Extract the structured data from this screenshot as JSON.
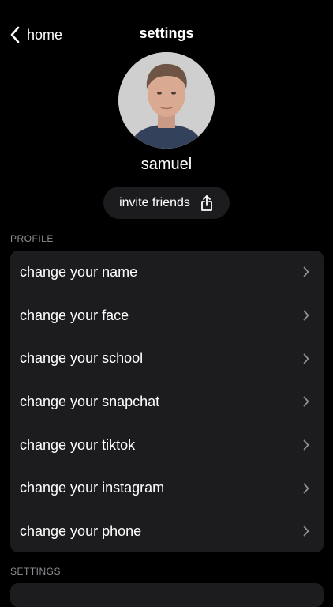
{
  "nav": {
    "back_label": "home",
    "title": "settings"
  },
  "profile": {
    "username": "samuel",
    "invite_label": "invite friends"
  },
  "sections": {
    "profile_header": "PROFILE",
    "settings_header": "SETTINGS"
  },
  "profile_items": [
    {
      "label": "change your name"
    },
    {
      "label": "change your face"
    },
    {
      "label": "change your school"
    },
    {
      "label": "change your snapchat"
    },
    {
      "label": "change your tiktok"
    },
    {
      "label": "change your instagram"
    },
    {
      "label": "change your phone"
    }
  ],
  "icons": {
    "back": "chevron-left-icon",
    "invite": "share-icon",
    "row": "chevron-right-icon"
  },
  "colors": {
    "background": "#000000",
    "card": "#1c1c1e",
    "secondary_text": "#8e8e93",
    "chevron": "#8e8e93"
  }
}
